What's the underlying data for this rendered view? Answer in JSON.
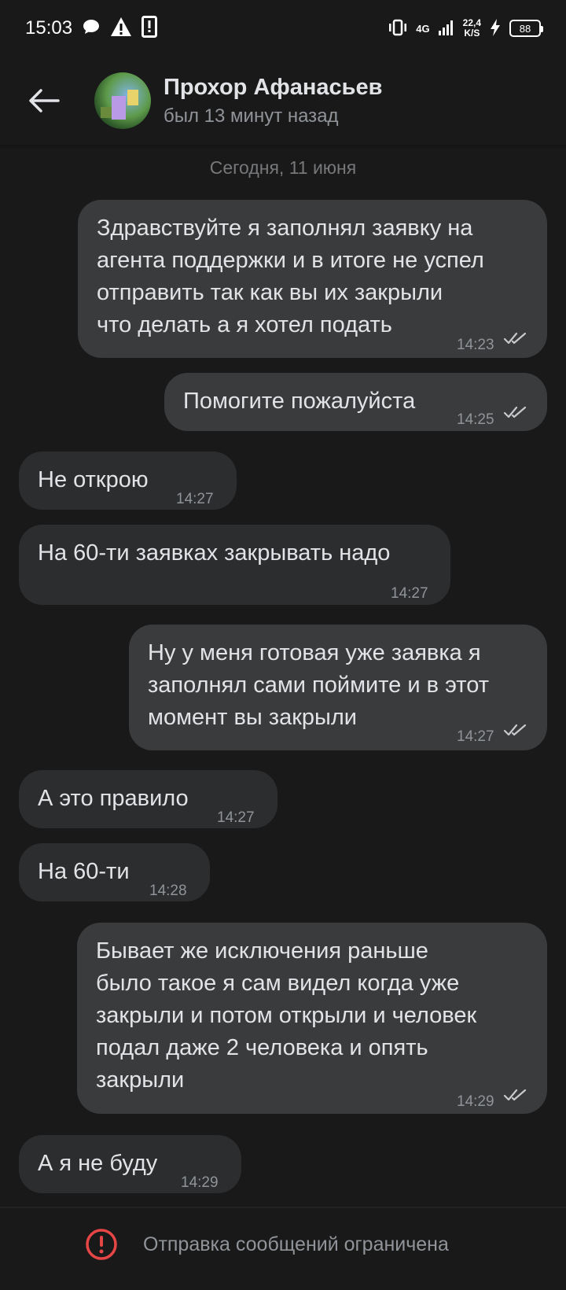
{
  "status_bar": {
    "time": "15:03",
    "network": "4G",
    "speed_value": "22,4",
    "speed_unit": "K/S",
    "battery": "88"
  },
  "header": {
    "contact_name": "Прохор Афанасьев",
    "contact_status": "был 13 минут назад"
  },
  "date_separator": "Сегодня, 11 июня",
  "messages": [
    {
      "direction": "out",
      "text": "Здравствуйте я заполнял заявку на\nагента поддержки и в итоге не успел\nотправить так как вы их закрыли\nчто делать а я хотел подать",
      "time": "14:23"
    },
    {
      "direction": "out",
      "text": "Помогите пожалуйста",
      "time": "14:25"
    },
    {
      "direction": "in",
      "text": "Не открою",
      "time": "14:27"
    },
    {
      "direction": "in",
      "text": "На 60-ти заявках закрывать надо",
      "time": "14:27"
    },
    {
      "direction": "out",
      "text": "Ну у меня готовая уже заявка я\nзаполнял сами поймите и в этот\nмомент вы закрыли",
      "time": "14:27"
    },
    {
      "direction": "in",
      "text": "А это правило",
      "time": "14:27"
    },
    {
      "direction": "in",
      "text": "На 60-ти",
      "time": "14:28"
    },
    {
      "direction": "out",
      "text": "Бывает же исключения раньше\nбыло такое я сам видел когда уже\nзакрыли и потом открыли и человек\nподал даже 2 человека и опять\nзакрыли",
      "time": "14:29"
    },
    {
      "direction": "in",
      "text": "А я не буду",
      "time": "14:29"
    }
  ],
  "bottom": {
    "restricted_text": "Отправка сообщений ограничена"
  },
  "colors": {
    "background": "#19191a",
    "outgoing_bubble": "#3a3b3c",
    "incoming_bubble": "#2c2d2e",
    "alert": "#e64646"
  }
}
